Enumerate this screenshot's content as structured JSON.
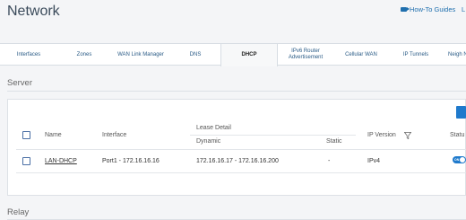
{
  "header": {
    "title": "Network",
    "guides_label": "How-To Guides",
    "extra_link": "L"
  },
  "tabs": [
    {
      "label": "Interfaces"
    },
    {
      "label": "Zones"
    },
    {
      "label": "WAN Link Manager"
    },
    {
      "label": "DNS"
    },
    {
      "label": "DHCP",
      "active": true
    },
    {
      "label": "IPv6 Router Advertisement"
    },
    {
      "label": "Cellular WAN"
    },
    {
      "label": "IP Tunnels"
    },
    {
      "label": "Neigh N"
    }
  ],
  "server": {
    "title": "Server",
    "columns": {
      "name": "Name",
      "interface": "Interface",
      "lease_detail": "Lease Detail",
      "dynamic": "Dynamic",
      "static": "Static",
      "ip_version": "IP Version",
      "status": "Statu"
    },
    "rows": [
      {
        "name": "LAN-DHCP",
        "interface": "Port1 - 172.16.16.16",
        "dynamic": "172.16.16.17 - 172.16.16.200",
        "static": "-",
        "ip_version": "IPv4",
        "status_toggle": "ON"
      }
    ]
  },
  "relay": {
    "title": "Relay"
  },
  "colors": {
    "accent": "#1f7acc",
    "link": "#1f6fae"
  }
}
